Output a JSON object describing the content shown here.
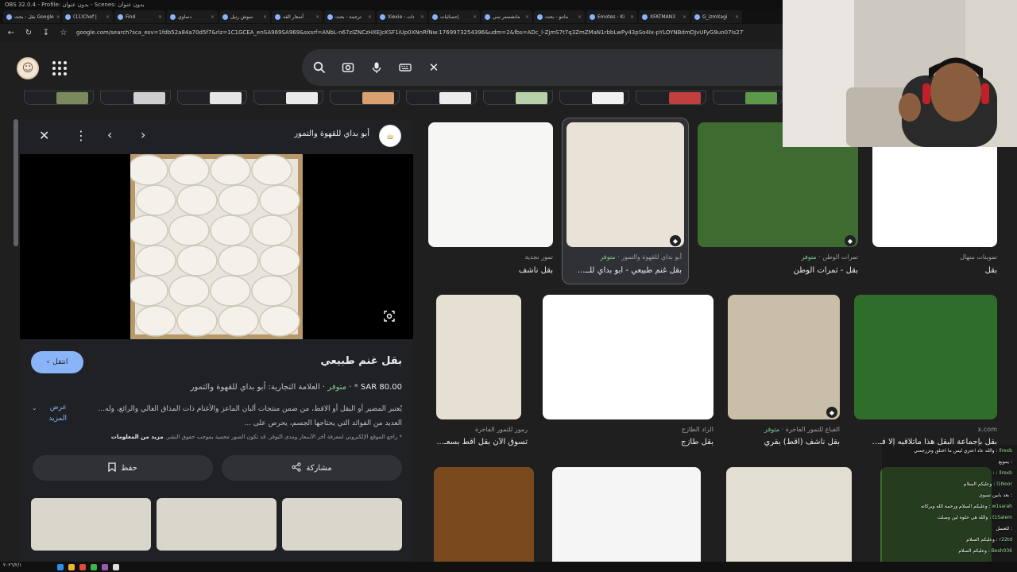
{
  "obs_title": "OBS 32.0.4 - Profile: بدون عنوان - Scenes: بدون عنوان",
  "tabs": [
    "بقل - بحث Google",
    "(11)Chef إ",
    "Find",
    "دساوي",
    "سوش رنيل",
    "أسعار القه",
    "ترجمة - بحث",
    "Xiexie - تات",
    "إحصائيات",
    "مانشستر سي",
    "ماننو - بحث",
    "Emotes - Ki",
    "XFATMAN3",
    "G_izmXagi"
  ],
  "url": "google.com/search?sca_esv=1fdb52a84a70d5f7&rlz=1C1GCEA_enSA969SA969&sxsrf=ANbL-n67zIZNCzHXEJcKSF1iUp0XNnRfNw:1769973254396&udm=2&fbs=ADc_l-ZjmS7t7q3ZmZMaN1rbbLwPy43pSo4Ix-pYLOYNBdmDJvUFyG9un07Is27Yk8K2gMTqtQ2ozFxiZGm_ciEEfVl",
  "header": {
    "avatar_glyph": "☺",
    "close_glyph": "✕"
  },
  "chips": [
    "#7a8a5a",
    "#cfcfcf",
    "#e6e6e6",
    "#eaeaea",
    "#d9a070",
    "#ececec",
    "#b9d1a8",
    "#f2f2f2",
    "#c04040",
    "#5c9a4a"
  ],
  "panel": {
    "site_name": "أبو بداي للقهوة والتمور",
    "site_glyph": "☕",
    "visit_label": "انتقل",
    "title": "بقل غنم طبيعي",
    "price": "SAR 80.00",
    "stock": "متوفر",
    "brand": "العلامة التجارية: أبو بداي للقهوة والتمور",
    "description": "يُعتبر المضير أو البقل أو الاقط، من ضمن منتجات ألبان الماعز والأغنام ذات المذاق العالي والرائع، وله... العديد من الفوائد التي يحتاجها الجسم، يحرص على ...",
    "more_label": "عرض المزيد",
    "note": "* راجع الموقع الإلكتروني لمعرفة آخر الأسعار ومدى التوفر. قد تكون الصور محمية بموجب حقوق النشر.",
    "note_link": "مزيد من المعلومات",
    "save_label": "حفظ",
    "share_label": "مشاركة"
  },
  "results": [
    {
      "source": "تمور نجدية",
      "title": "بقل ناشف",
      "color": "#f6f6f4"
    },
    {
      "source": "أبو بداي للقهوة والتمور",
      "stock": "متوفر",
      "title": "بقل غنم طبيعي - أبو بداي للــ...",
      "color": "#e8e3d6"
    },
    {
      "source": "تمرات الوطن",
      "stock": "متوفر",
      "title": "بقل - ثمرات الوطن",
      "color": "#3e6b2f"
    },
    {
      "source": "تموينات منهال",
      "title": "بقل",
      "color": "#ffffff"
    },
    {
      "source": "رموز للتمور الفاخرة",
      "title": "تسوق الآن بقل أقط بسعـ...",
      "color": "#e6e0d2"
    },
    {
      "source": "الزاد الطازج",
      "title": "بقل طازج",
      "color": "#ffffff"
    },
    {
      "source": "القباع للتمور الفاخرة",
      "stock": "متوفر",
      "title": "بقل ناشف (اقط) بقري",
      "color": "#c9bfa8"
    },
    {
      "source": "x.com",
      "title": "بقل بإجماعة البقل هذا ماتلاقيه إلا فـ...",
      "color": "#2f6e2a"
    }
  ],
  "chat": [
    {
      "user": "llrexb",
      "msg": "والله عاد اعتزي ليس ما اختلق وتزرجمني"
    },
    {
      "user": "",
      "msg": "يموبع"
    },
    {
      "user": "llrexb",
      "msg": ":"
    },
    {
      "user": "l1Noor",
      "msg": "وعليكم السلام"
    },
    {
      "user": "",
      "msg": "بعد بابين تسوى"
    },
    {
      "user": "w1sarah",
      "msg": "وعليكم السلام ورحمة الله وبركاته"
    },
    {
      "user": "t1Salem",
      "msg": "والله هي حلوه لين وصلت"
    },
    {
      "user": "",
      "msg": "للعسل"
    },
    {
      "user": "r22td",
      "msg": "وعليكم السلام"
    },
    {
      "user": "Besh036",
      "msg": "وعليكم السلام"
    }
  ],
  "clock": "٢٠٢٦/٢/١"
}
